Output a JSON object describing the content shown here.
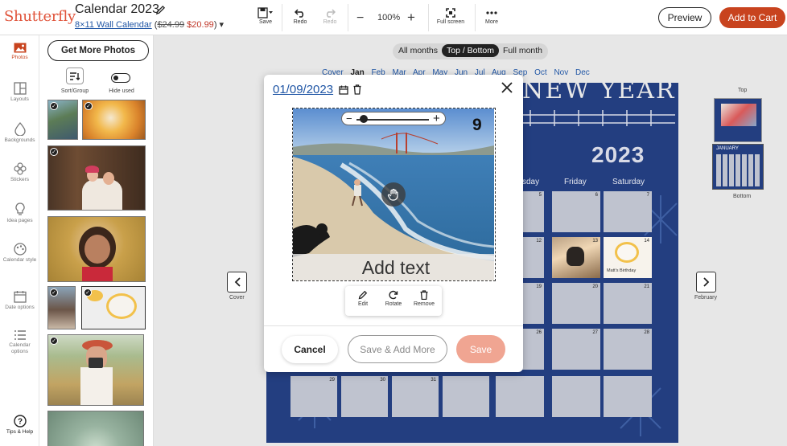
{
  "header": {
    "logo": "Shutterfly",
    "project_title": "Calendar 2023",
    "product_size": "8×11 Wall Calendar",
    "price_original": "$24.99",
    "price_sale": "$20.99",
    "toolbar": {
      "save": "Save",
      "redo": "Redo",
      "redo_disabled": "Redo",
      "zoom": "100%",
      "full_screen": "Full screen",
      "more": "More"
    },
    "preview": "Preview",
    "add_to_cart": "Add to Cart"
  },
  "rail": {
    "items": [
      {
        "label": "Photos",
        "icon": "photos-icon"
      },
      {
        "label": "Layouts",
        "icon": "layouts-icon"
      },
      {
        "label": "Backgrounds",
        "icon": "backgrounds-icon"
      },
      {
        "label": "Stickers",
        "icon": "stickers-icon"
      },
      {
        "label": "Idea pages",
        "icon": "idea-pages-icon"
      },
      {
        "label": "Calendar style",
        "icon": "calendar-style-icon"
      },
      {
        "label": "Date options",
        "icon": "date-options-icon"
      },
      {
        "label": "Calendar options",
        "icon": "calendar-options-icon"
      },
      {
        "label": "Tips & Help",
        "icon": "help-icon"
      }
    ],
    "active_color": "#c8431e"
  },
  "panel": {
    "get_more": "Get More Photos",
    "sort_label": "Sort/Group",
    "hide_used_label": "Hide used"
  },
  "canvas": {
    "view_modes": [
      "All months",
      "Top / Bottom",
      "Full month"
    ],
    "selected_view": "Top / Bottom",
    "months": [
      "Cover",
      "Jan",
      "Feb",
      "Mar",
      "Apr",
      "May",
      "Jun",
      "Jul",
      "Aug",
      "Sep",
      "Oct",
      "Nov",
      "Dec"
    ],
    "current_month": "Jan",
    "year": "2023",
    "heading_partial": "NEW YEAR",
    "weekdays_visible": [
      "sday",
      "Friday",
      "Saturday"
    ],
    "day_numbers": [
      "5",
      "6",
      "7",
      "12",
      "13",
      "14",
      "19",
      "20",
      "21",
      "26",
      "27",
      "28",
      "29",
      "30",
      "31"
    ],
    "birthday_caption": "Matt's Birthday",
    "prev_label": "Cover",
    "next_label": "February",
    "thumb_top_label": "Top",
    "thumb_bottom_label": "Bottom",
    "thumb_month": "JANUARY",
    "calendar_color": "#233e80"
  },
  "modal": {
    "date": "01/09/2023",
    "day_number": "9",
    "caption_placeholder": "Add text",
    "actions": {
      "edit": "Edit",
      "rotate": "Rotate",
      "remove": "Remove"
    },
    "cancel": "Cancel",
    "save_add_more": "Save & Add More",
    "save": "Save",
    "save_color": "#f0a592"
  }
}
